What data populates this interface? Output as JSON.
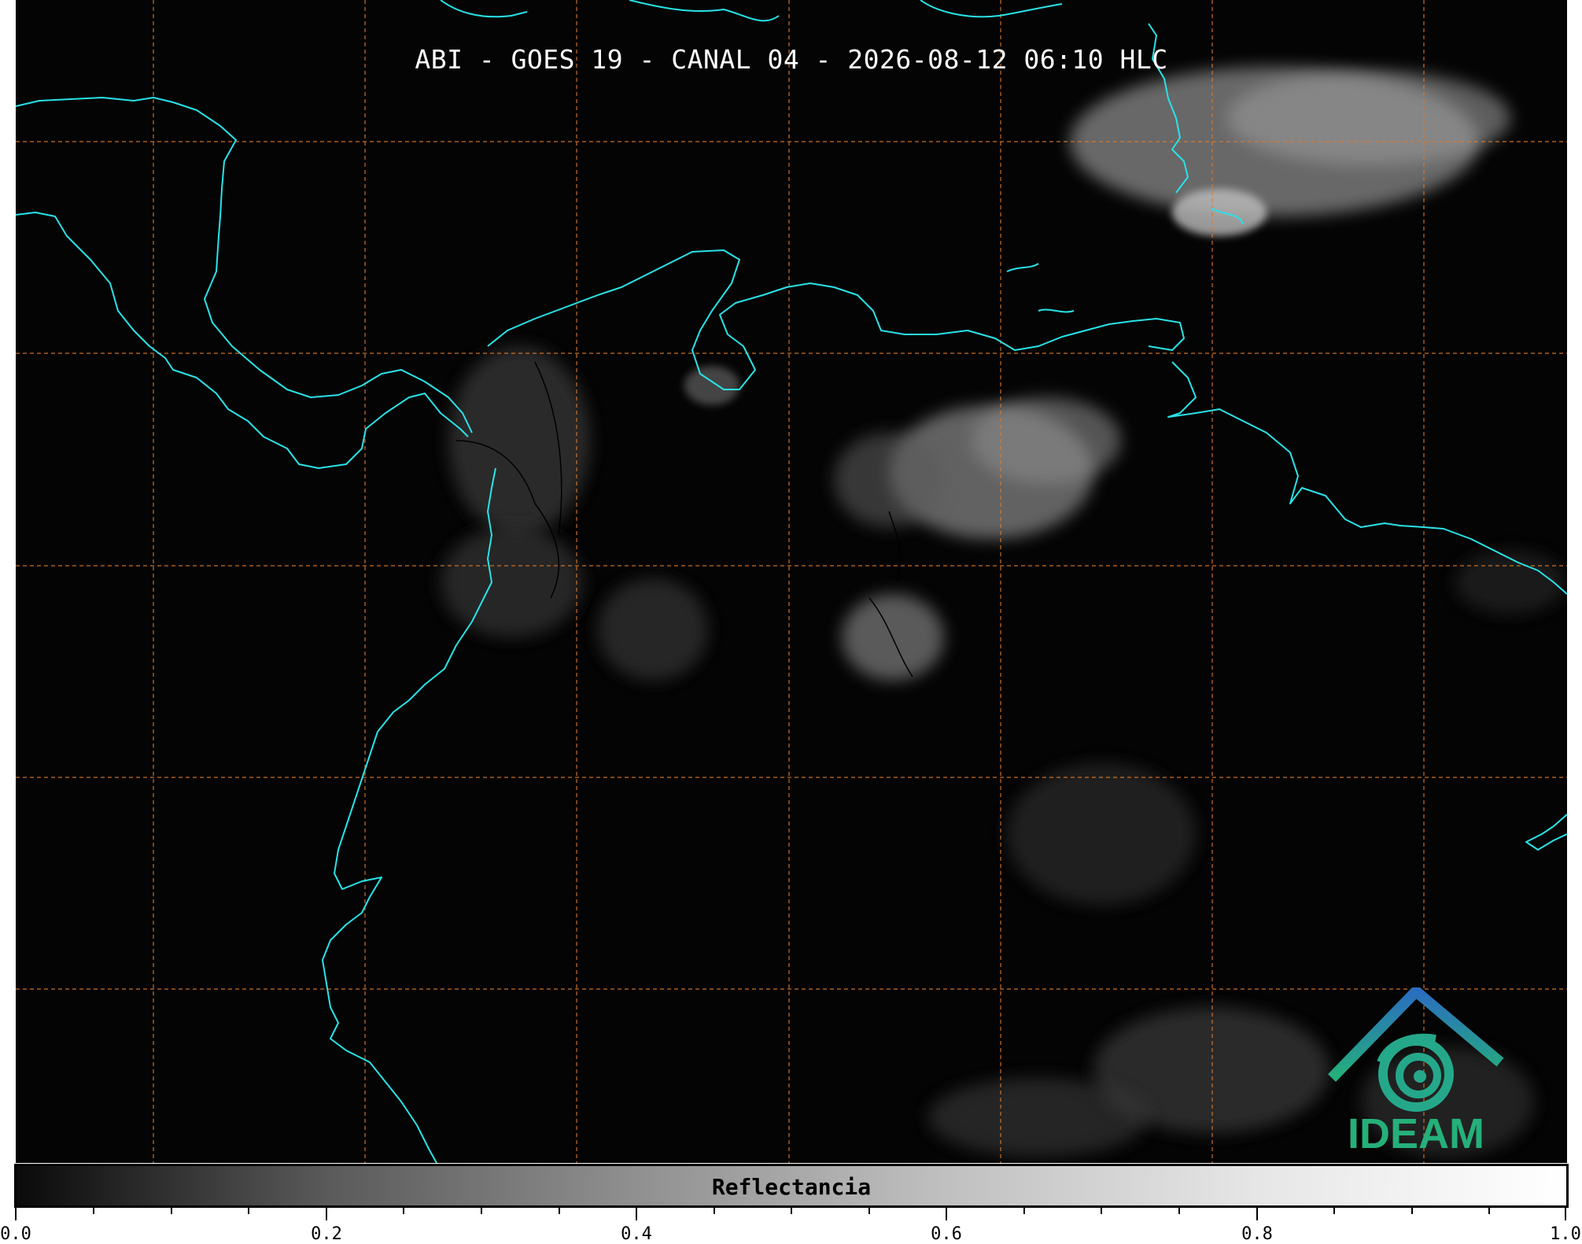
{
  "title": "ABI - GOES 19 - CANAL 04 - 2026-08-12 06:10 HLC",
  "colorbar": {
    "label": "Reflectancia",
    "ticks": [
      "0.0",
      "0.2",
      "0.4",
      "0.6",
      "0.8",
      "1.0"
    ],
    "range": [
      0.0,
      1.0
    ],
    "colormap": "grayscale"
  },
  "logo": {
    "text": "IDEAM"
  },
  "colors": {
    "background": "#040404",
    "coastline": "#29e3e8",
    "gridlines": "#e07a2a",
    "borders": "#000000",
    "logo_green": "#25b07a",
    "logo_blue": "#2a6ec0"
  }
}
